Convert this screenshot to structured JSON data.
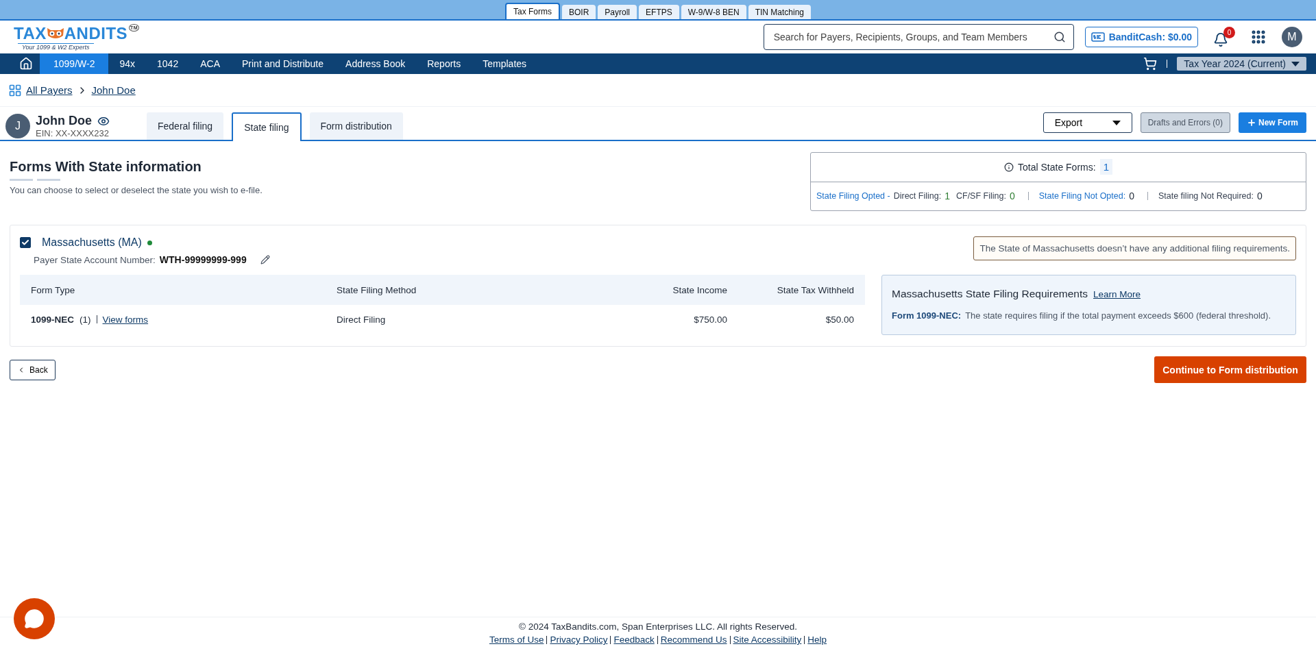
{
  "product_tabs": [
    {
      "label": "Tax Forms",
      "selected": true
    },
    {
      "label": "BOIR",
      "selected": false
    },
    {
      "label": "Payroll",
      "selected": false
    },
    {
      "label": "EFTPS",
      "selected": false
    },
    {
      "label": "W-9/W-8 BEN",
      "selected": false
    },
    {
      "label": "TIN Matching",
      "selected": false
    }
  ],
  "logo": {
    "before": "TAX",
    "after": "ANDITS",
    "trademark": "TM",
    "tagline": "Your 1099 & W2 Experts"
  },
  "search": {
    "placeholder": "Search for Payers, Recipients, Groups, and Team Members"
  },
  "bandit_cash": "BanditCash: $0.00",
  "notifications": "0",
  "user_avatar": "M",
  "nav": [
    {
      "label": "1099/W-2",
      "selected": true
    },
    {
      "label": "94x",
      "selected": false
    },
    {
      "label": "1042",
      "selected": false
    },
    {
      "label": "ACA",
      "selected": false
    },
    {
      "label": "Print and Distribute",
      "selected": false
    },
    {
      "label": "Address Book",
      "selected": false
    },
    {
      "label": "Reports",
      "selected": false
    },
    {
      "label": "Templates",
      "selected": false
    }
  ],
  "tax_year": "Tax Year 2024 (Current)",
  "breadcrumb": [
    "All Payers",
    "John Doe"
  ],
  "payer": {
    "initial": "J",
    "name": "John Doe",
    "ein": "EIN: XX-XXXX232"
  },
  "filing_tabs": [
    {
      "label": "Federal filing",
      "selected": false
    },
    {
      "label": "State filing",
      "selected": true
    },
    {
      "label": "Form distribution",
      "selected": false
    }
  ],
  "actions": {
    "export": "Export",
    "drafts": {
      "label": "Drafts and Errors (0)",
      "disabled": true
    },
    "new_form": "New Form"
  },
  "section": {
    "title": "Forms With State information",
    "subtitle": "You can choose to select or deselect the state you wish to e-file."
  },
  "summary": {
    "total_label": "Total State Forms:",
    "total": "1",
    "breakdown": [
      {
        "kind": "link",
        "label": "State Filing Opted -"
      },
      {
        "kind": "plain",
        "label": "Direct Filing:",
        "value": "1",
        "color": "#2e7d32"
      },
      {
        "kind": "plain",
        "label": "CF/SF Filing:",
        "value": "0",
        "color": "#2e7d32"
      },
      {
        "kind": "separator"
      },
      {
        "kind": "link",
        "label": "State Filing Not Opted:",
        "value": "0",
        "color": "#1f2937"
      },
      {
        "kind": "separator"
      },
      {
        "kind": "plain",
        "label": "State filing Not Required:",
        "value": "0",
        "color": "#1f2937"
      }
    ]
  },
  "state": {
    "checked": true,
    "name": "Massachusetts (MA)",
    "active": true,
    "account_label": "Payer State Account Number:",
    "account_number": "WTH-99999999-999",
    "notice": "The State of Massachusetts doesn’t have any additional filing requirements.",
    "columns": [
      "Form Type",
      "State Filing Method",
      "State Income",
      "State Tax Withheld"
    ],
    "rows": [
      {
        "form_type": "1099-NEC",
        "count": "(1)",
        "link": "View forms",
        "method": "Direct Filing",
        "income": "$750.00",
        "withheld": "$50.00"
      }
    ],
    "requirements": {
      "title": "Massachusetts State Filing Requirements",
      "link": "Learn More",
      "form": "Form 1099-NEC:",
      "text": "The state requires filing if the total payment exceeds $600 (federal threshold)."
    }
  },
  "back": "Back",
  "continue": "Continue to Form distribution",
  "footer": {
    "copyright": "© 2024 TaxBandits.com, Span Enterprises LLC. All rights Reserved.",
    "links": [
      "Terms of Use",
      "Privacy Policy",
      "Feedback",
      "Recommend Us",
      "Site Accessibility",
      "Help"
    ]
  }
}
